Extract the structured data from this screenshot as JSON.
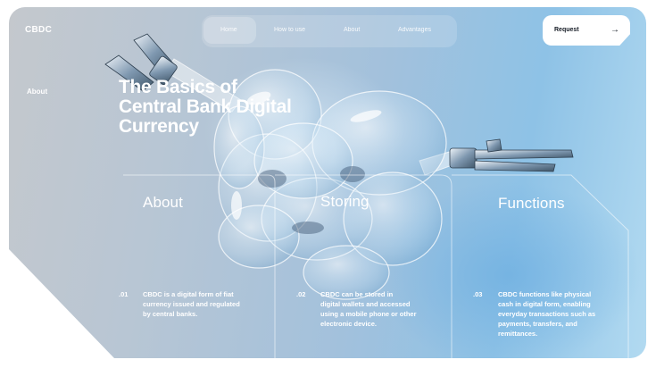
{
  "brand": "CBDC",
  "nav": {
    "items": [
      "Home",
      "How to use",
      "About",
      "Advantages"
    ],
    "active": "Home"
  },
  "request_button": {
    "label": "Request",
    "icon": "arrow-right-icon"
  },
  "side_link": "About",
  "hero": {
    "title_lines": [
      "The Basics of",
      "Central Bank Digital",
      "Currency"
    ]
  },
  "columns": [
    {
      "title": "About",
      "num": ".01",
      "text_lines": [
        "CBDC is a digital form of fiat",
        "currency issued and regulated",
        "by central banks."
      ]
    },
    {
      "title": "Storing",
      "num": ".02",
      "text_lines": [
        "CBDC can be stored in",
        "digital wallets and accessed",
        "using a mobile phone or other",
        "electronic device."
      ]
    },
    {
      "title": "Functions",
      "num": ".03",
      "text_lines": [
        "CBDC functions like physical",
        "cash in digital form, enabling",
        "everyday transactions such as",
        "payments, transfers, and",
        "remittances."
      ]
    }
  ],
  "colors": {
    "card_gradient_start": "#c4c8cd",
    "card_gradient_end": "#8ec2e6",
    "text": "#ffffff",
    "button_bg": "#ffffff"
  }
}
